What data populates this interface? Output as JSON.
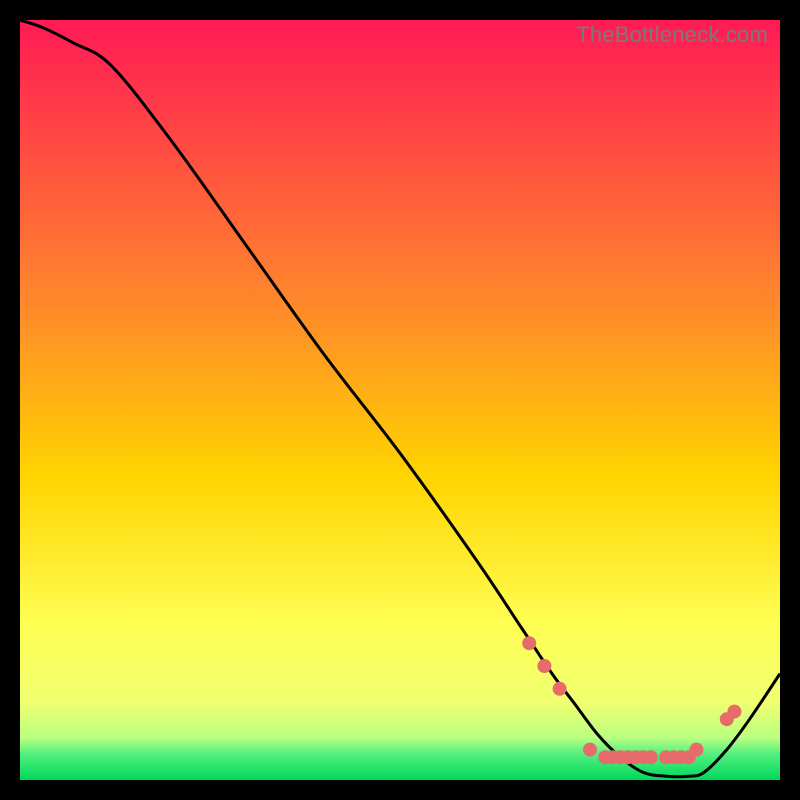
{
  "watermark": "TheBottleneck.com",
  "colors": {
    "bg_black": "#000000",
    "grad_top": "#ff1a55",
    "grad_mid": "#ffd400",
    "grad_yellow_soft": "#ffff66",
    "grad_green": "#00e060",
    "curve": "#000000",
    "marker": "#e86b6b"
  },
  "chart_data": {
    "type": "line",
    "title": "",
    "xlabel": "",
    "ylabel": "",
    "xlim": [
      0,
      100
    ],
    "ylim": [
      0,
      100
    ],
    "x": [
      0,
      3,
      7,
      12,
      20,
      30,
      40,
      50,
      60,
      66,
      70,
      73,
      76,
      79,
      82,
      85,
      88,
      90,
      93,
      96,
      100
    ],
    "values": [
      100,
      99,
      97,
      94,
      84,
      70,
      56,
      43,
      29,
      20,
      14,
      10,
      6,
      3,
      1,
      0.5,
      0.5,
      1,
      4,
      8,
      14
    ],
    "marker_points": [
      {
        "x": 67,
        "y": 18
      },
      {
        "x": 69,
        "y": 15
      },
      {
        "x": 71,
        "y": 12
      },
      {
        "x": 75,
        "y": 4
      },
      {
        "x": 77,
        "y": 3
      },
      {
        "x": 78,
        "y": 3
      },
      {
        "x": 79,
        "y": 3
      },
      {
        "x": 80,
        "y": 3
      },
      {
        "x": 81,
        "y": 3
      },
      {
        "x": 82,
        "y": 3
      },
      {
        "x": 83,
        "y": 3
      },
      {
        "x": 85,
        "y": 3
      },
      {
        "x": 86,
        "y": 3
      },
      {
        "x": 87,
        "y": 3
      },
      {
        "x": 88,
        "y": 3
      },
      {
        "x": 89,
        "y": 4
      },
      {
        "x": 93,
        "y": 8
      },
      {
        "x": 94,
        "y": 9
      }
    ],
    "gradient_stops": [
      {
        "offset": 0.0,
        "color": "#ff1a55"
      },
      {
        "offset": 0.38,
        "color": "#ff8a2a"
      },
      {
        "offset": 0.6,
        "color": "#ffd400"
      },
      {
        "offset": 0.8,
        "color": "#ffff55"
      },
      {
        "offset": 0.9,
        "color": "#eeff70"
      },
      {
        "offset": 0.945,
        "color": "#b8ff80"
      },
      {
        "offset": 0.965,
        "color": "#55f080"
      },
      {
        "offset": 1.0,
        "color": "#00d85a"
      }
    ]
  }
}
